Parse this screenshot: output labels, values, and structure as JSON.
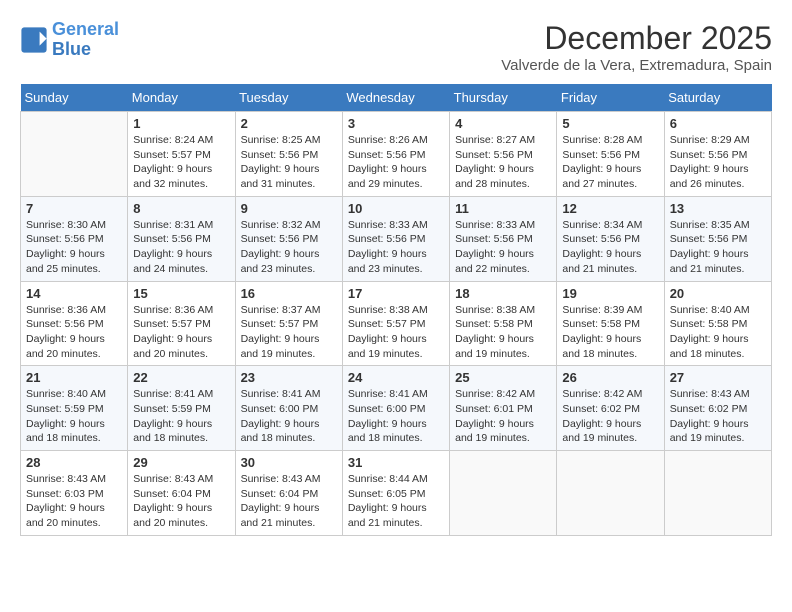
{
  "header": {
    "logo_line1": "General",
    "logo_line2": "Blue",
    "month_year": "December 2025",
    "location": "Valverde de la Vera, Extremadura, Spain"
  },
  "weekdays": [
    "Sunday",
    "Monday",
    "Tuesday",
    "Wednesday",
    "Thursday",
    "Friday",
    "Saturday"
  ],
  "weeks": [
    [
      {
        "day": "",
        "sunrise": "",
        "sunset": "",
        "daylight": ""
      },
      {
        "day": "1",
        "sunrise": "8:24 AM",
        "sunset": "5:57 PM",
        "daylight": "9 hours and 32 minutes."
      },
      {
        "day": "2",
        "sunrise": "8:25 AM",
        "sunset": "5:56 PM",
        "daylight": "9 hours and 31 minutes."
      },
      {
        "day": "3",
        "sunrise": "8:26 AM",
        "sunset": "5:56 PM",
        "daylight": "9 hours and 29 minutes."
      },
      {
        "day": "4",
        "sunrise": "8:27 AM",
        "sunset": "5:56 PM",
        "daylight": "9 hours and 28 minutes."
      },
      {
        "day": "5",
        "sunrise": "8:28 AM",
        "sunset": "5:56 PM",
        "daylight": "9 hours and 27 minutes."
      },
      {
        "day": "6",
        "sunrise": "8:29 AM",
        "sunset": "5:56 PM",
        "daylight": "9 hours and 26 minutes."
      }
    ],
    [
      {
        "day": "7",
        "sunrise": "8:30 AM",
        "sunset": "5:56 PM",
        "daylight": "9 hours and 25 minutes."
      },
      {
        "day": "8",
        "sunrise": "8:31 AM",
        "sunset": "5:56 PM",
        "daylight": "9 hours and 24 minutes."
      },
      {
        "day": "9",
        "sunrise": "8:32 AM",
        "sunset": "5:56 PM",
        "daylight": "9 hours and 23 minutes."
      },
      {
        "day": "10",
        "sunrise": "8:33 AM",
        "sunset": "5:56 PM",
        "daylight": "9 hours and 23 minutes."
      },
      {
        "day": "11",
        "sunrise": "8:33 AM",
        "sunset": "5:56 PM",
        "daylight": "9 hours and 22 minutes."
      },
      {
        "day": "12",
        "sunrise": "8:34 AM",
        "sunset": "5:56 PM",
        "daylight": "9 hours and 21 minutes."
      },
      {
        "day": "13",
        "sunrise": "8:35 AM",
        "sunset": "5:56 PM",
        "daylight": "9 hours and 21 minutes."
      }
    ],
    [
      {
        "day": "14",
        "sunrise": "8:36 AM",
        "sunset": "5:56 PM",
        "daylight": "9 hours and 20 minutes."
      },
      {
        "day": "15",
        "sunrise": "8:36 AM",
        "sunset": "5:57 PM",
        "daylight": "9 hours and 20 minutes."
      },
      {
        "day": "16",
        "sunrise": "8:37 AM",
        "sunset": "5:57 PM",
        "daylight": "9 hours and 19 minutes."
      },
      {
        "day": "17",
        "sunrise": "8:38 AM",
        "sunset": "5:57 PM",
        "daylight": "9 hours and 19 minutes."
      },
      {
        "day": "18",
        "sunrise": "8:38 AM",
        "sunset": "5:58 PM",
        "daylight": "9 hours and 19 minutes."
      },
      {
        "day": "19",
        "sunrise": "8:39 AM",
        "sunset": "5:58 PM",
        "daylight": "9 hours and 18 minutes."
      },
      {
        "day": "20",
        "sunrise": "8:40 AM",
        "sunset": "5:58 PM",
        "daylight": "9 hours and 18 minutes."
      }
    ],
    [
      {
        "day": "21",
        "sunrise": "8:40 AM",
        "sunset": "5:59 PM",
        "daylight": "9 hours and 18 minutes."
      },
      {
        "day": "22",
        "sunrise": "8:41 AM",
        "sunset": "5:59 PM",
        "daylight": "9 hours and 18 minutes."
      },
      {
        "day": "23",
        "sunrise": "8:41 AM",
        "sunset": "6:00 PM",
        "daylight": "9 hours and 18 minutes."
      },
      {
        "day": "24",
        "sunrise": "8:41 AM",
        "sunset": "6:00 PM",
        "daylight": "9 hours and 18 minutes."
      },
      {
        "day": "25",
        "sunrise": "8:42 AM",
        "sunset": "6:01 PM",
        "daylight": "9 hours and 19 minutes."
      },
      {
        "day": "26",
        "sunrise": "8:42 AM",
        "sunset": "6:02 PM",
        "daylight": "9 hours and 19 minutes."
      },
      {
        "day": "27",
        "sunrise": "8:43 AM",
        "sunset": "6:02 PM",
        "daylight": "9 hours and 19 minutes."
      }
    ],
    [
      {
        "day": "28",
        "sunrise": "8:43 AM",
        "sunset": "6:03 PM",
        "daylight": "9 hours and 20 minutes."
      },
      {
        "day": "29",
        "sunrise": "8:43 AM",
        "sunset": "6:04 PM",
        "daylight": "9 hours and 20 minutes."
      },
      {
        "day": "30",
        "sunrise": "8:43 AM",
        "sunset": "6:04 PM",
        "daylight": "9 hours and 21 minutes."
      },
      {
        "day": "31",
        "sunrise": "8:44 AM",
        "sunset": "6:05 PM",
        "daylight": "9 hours and 21 minutes."
      },
      {
        "day": "",
        "sunrise": "",
        "sunset": "",
        "daylight": ""
      },
      {
        "day": "",
        "sunrise": "",
        "sunset": "",
        "daylight": ""
      },
      {
        "day": "",
        "sunrise": "",
        "sunset": "",
        "daylight": ""
      }
    ]
  ]
}
